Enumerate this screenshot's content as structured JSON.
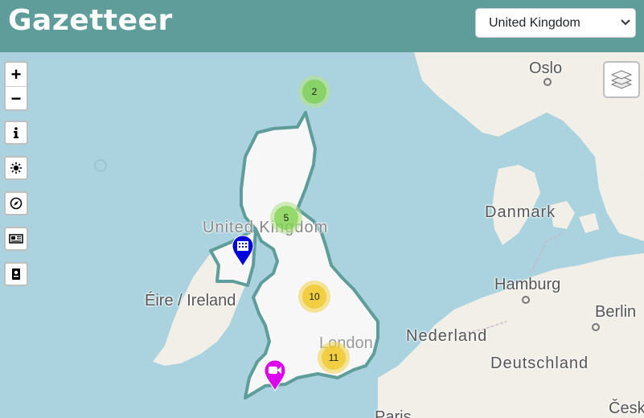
{
  "header": {
    "brand": "Gazetteer",
    "country_select": {
      "selected": "United Kingdom"
    }
  },
  "map": {
    "zoom_in_label": "+",
    "zoom_out_label": "−",
    "country_outline_color": "#5f9d9a",
    "labels": {
      "oslo": "Oslo",
      "danmark": "Danmark",
      "united_kingdom": "United Kingdom",
      "eire": "Éire / Ireland",
      "london": "London",
      "hamburg": "Hamburg",
      "berlin": "Berlin",
      "nederland": "Nederland",
      "deutschland": "Deutschland",
      "paris": "Paris",
      "cesko": "Česk"
    },
    "clusters": [
      {
        "count": "2",
        "color": "#b5e28c"
      },
      {
        "count": "5",
        "color": "#b5e28c"
      },
      {
        "count": "10",
        "color": "#f1d357"
      },
      {
        "count": "11",
        "color": "#f1d357"
      }
    ],
    "markers": {
      "airport": {
        "icon": "building-icon",
        "color": "#0000dd"
      },
      "webcam": {
        "icon": "video-camera-icon",
        "color": "#dd00ee"
      }
    }
  },
  "controls": {
    "info": "info-icon",
    "weather": "sun-icon",
    "compass": "compass-icon",
    "news": "newspaper-icon",
    "wiki": "book-icon",
    "layers": "layers-icon"
  }
}
